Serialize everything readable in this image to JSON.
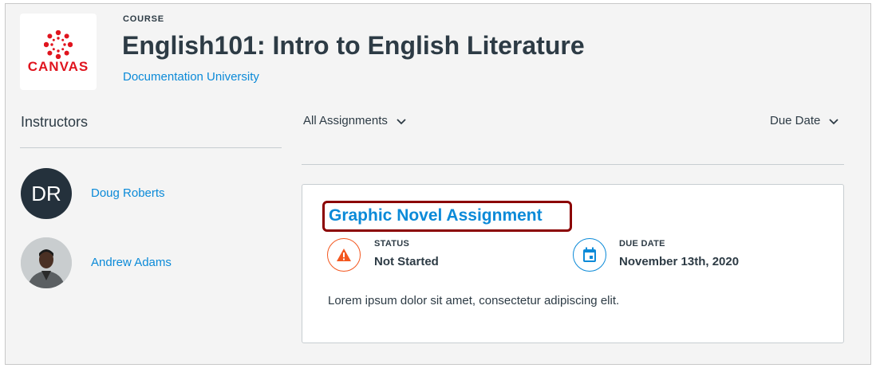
{
  "header": {
    "logo_text": "CANVAS",
    "eyebrow": "COURSE",
    "title": "English101: Intro to English Literature",
    "institution": "Documentation University"
  },
  "sidebar": {
    "heading": "Instructors",
    "instructors": [
      {
        "initials": "DR",
        "name": "Doug Roberts"
      },
      {
        "name": "Andrew Adams"
      }
    ]
  },
  "filters": {
    "assignments": "All Assignments",
    "sort": "Due Date"
  },
  "assignment": {
    "title": "Graphic Novel Assignment",
    "status_label": "STATUS",
    "status": "Not Started",
    "due_label": "DUE DATE",
    "due": "November 13th, 2020",
    "description": "Lorem ipsum dolor sit amet, consectetur adipiscing elit."
  },
  "colors": {
    "link": "#0b8ad8",
    "warning": "#f4571f",
    "highlight": "#8b0000"
  }
}
